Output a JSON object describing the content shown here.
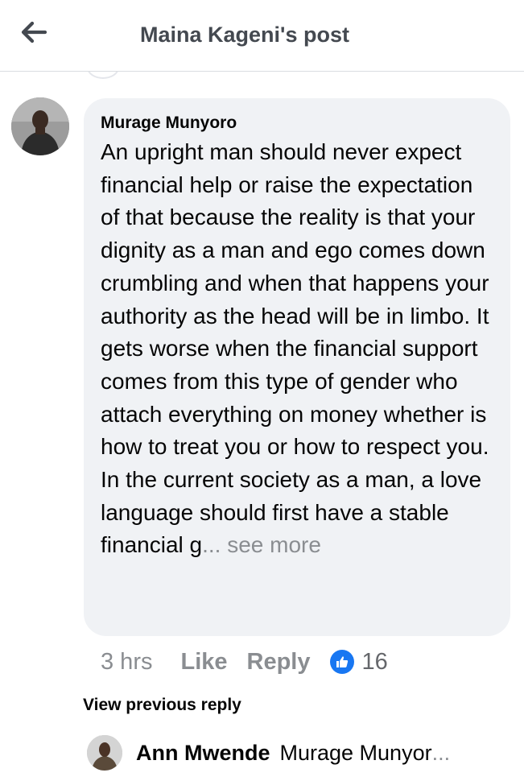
{
  "header": {
    "title": "Maina Kageni's post",
    "back_icon": "arrow-left-icon"
  },
  "comment": {
    "author": "Murage Munyoro",
    "text": "An upright man should never expect financial help or raise the expectation of that because the reality is that your dignity as a man and ego comes down crumbling and when that happens your authority as the head will be in limbo. It gets worse when the financial support comes from this type of gender who attach everything on money whether is how to treat you or how to respect you. In the current society as a man, a love language should first have a stable financial g",
    "truncation": "...",
    "see_more": " see more",
    "time": "3 hrs",
    "like_label": "Like",
    "reply_label": "Reply",
    "reaction_icon": "thumbs-up-icon",
    "reaction_count": "16"
  },
  "replies": {
    "view_previous": "View previous reply",
    "latest": {
      "author": "Ann Mwende",
      "snippet": "Murage Munyor",
      "ellipsis": "..."
    }
  },
  "colors": {
    "accent": "#1877f2",
    "bubble": "#f0f2f5",
    "muted": "#8a8d91",
    "text": "#050505"
  }
}
